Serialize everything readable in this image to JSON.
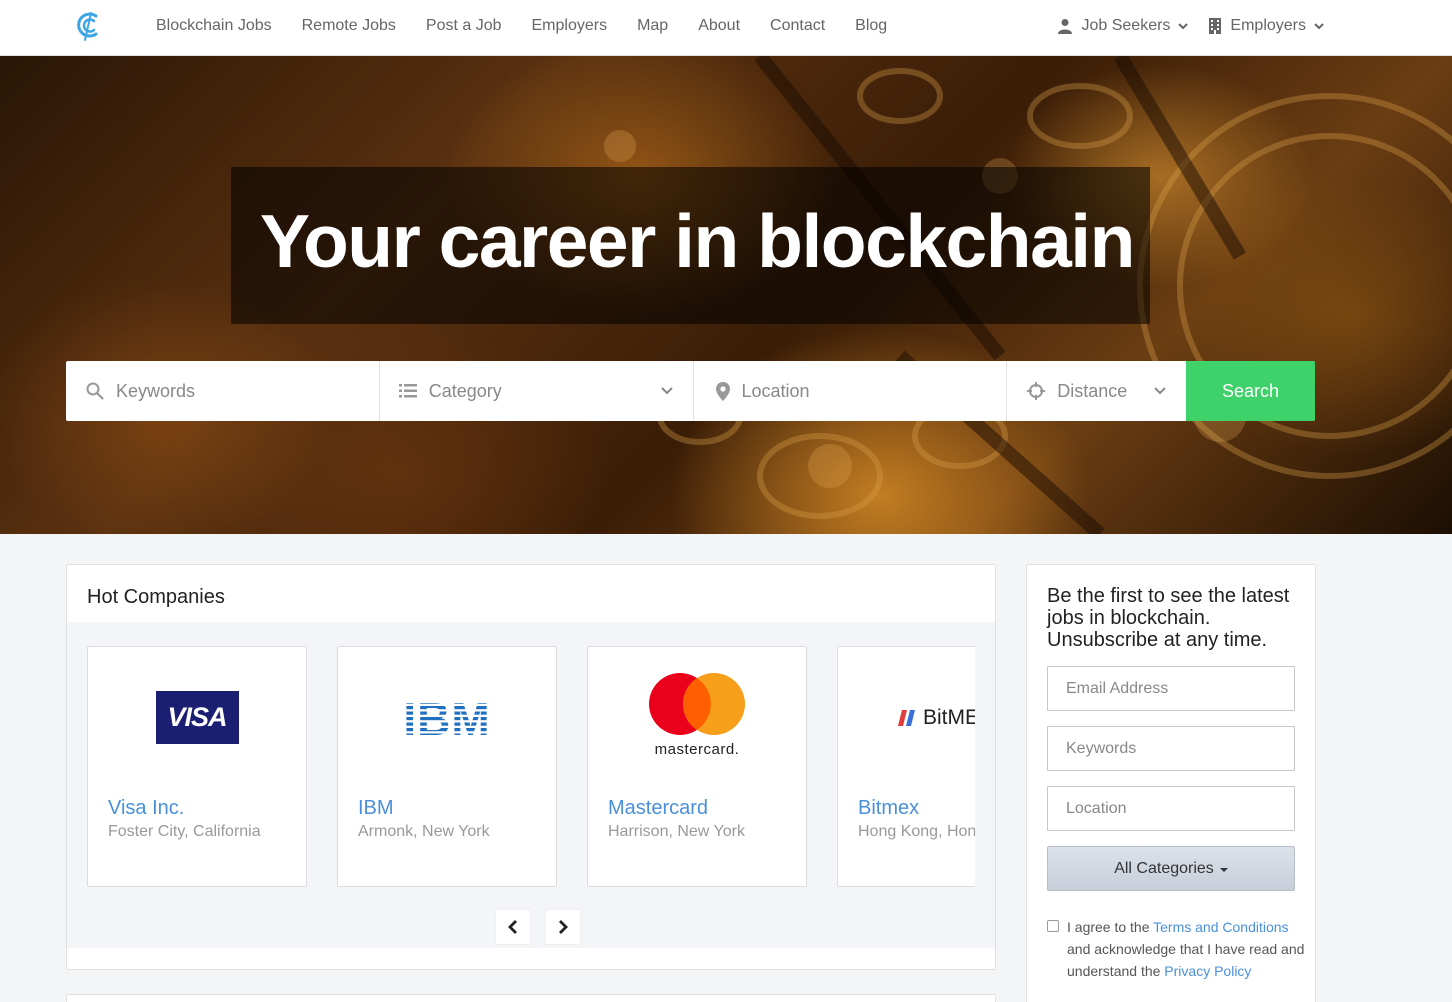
{
  "nav": {
    "links": [
      "Blockchain Jobs",
      "Remote Jobs",
      "Post a Job",
      "Employers",
      "Map",
      "About",
      "Contact",
      "Blog"
    ],
    "job_seekers": "Job Seekers",
    "employers": "Employers"
  },
  "hero": {
    "title": "Your career in blockchain"
  },
  "search": {
    "keywords_placeholder": "Keywords",
    "category_placeholder": "Category",
    "location_placeholder": "Location",
    "distance_placeholder": "Distance",
    "button": "Search"
  },
  "hot_companies": {
    "title": "Hot Companies",
    "companies": [
      {
        "name": "Visa Inc.",
        "location": "Foster City, California",
        "logo_text": "VISA"
      },
      {
        "name": "IBM",
        "location": "Armonk, New York",
        "logo_text": "IBM"
      },
      {
        "name": "Mastercard",
        "location": "Harrison, New York",
        "logo_text": "mastercard."
      },
      {
        "name": "Bitmex",
        "location": "Hong Kong, Hong Kong",
        "logo_text": "BitMEX"
      }
    ]
  },
  "subscribe": {
    "heading": "Be the first to see the latest jobs in blockchain. Unsubscribe at any time.",
    "email_placeholder": "Email Address",
    "keywords_placeholder": "Keywords",
    "location_placeholder": "Location",
    "categories": "All Categories",
    "agree_pre": "I agree to the ",
    "terms_link": "Terms and Conditions",
    "agree_mid": " and acknowledge that I have read and understand the ",
    "privacy_link": "Privacy Policy"
  },
  "colors": {
    "accent_green": "#3fd16a",
    "link_blue": "#4a90d9",
    "logo_blue": "#3da5e6",
    "visa_navy": "#1a1f71",
    "ibm_blue": "#1f70c1",
    "mastercard_red": "#eb001b",
    "mastercard_orange": "#f79e1b"
  }
}
